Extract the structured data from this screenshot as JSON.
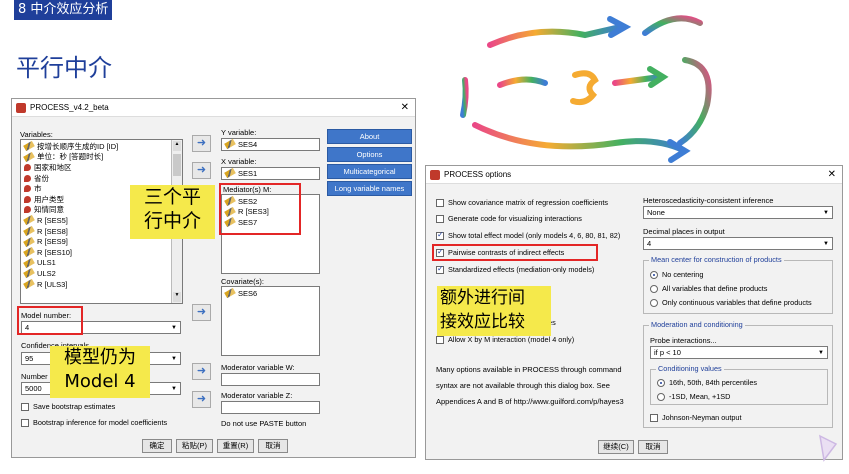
{
  "slide": {
    "section_tag": "8 中介效应分析",
    "title": "平行中介"
  },
  "dialog1": {
    "title": "PROCESS_v4.2_beta",
    "variables_label": "Variables:",
    "variables": [
      {
        "name": "按增长顺序生成的ID [ID]",
        "icon": "pencil-icon"
      },
      {
        "name": "单位：秒 [答题时长]",
        "icon": "pencil-icon"
      },
      {
        "name": "国家和地区",
        "icon": "nominal-icon"
      },
      {
        "name": "省份",
        "icon": "nominal-icon"
      },
      {
        "name": "市",
        "icon": "nominal-icon"
      },
      {
        "name": "用户类型",
        "icon": "nominal-icon"
      },
      {
        "name": "知情同意",
        "icon": "nominal-icon"
      },
      {
        "name": "R [SES5]",
        "icon": "pencil-icon"
      },
      {
        "name": "R [SES8]",
        "icon": "pencil-icon"
      },
      {
        "name": "R [SES9]",
        "icon": "pencil-icon"
      },
      {
        "name": "R [SES10]",
        "icon": "pencil-icon"
      },
      {
        "name": "ULS1",
        "icon": "pencil-icon"
      },
      {
        "name": "ULS2",
        "icon": "pencil-icon"
      },
      {
        "name": "R [ULS3]",
        "icon": "pencil-icon"
      }
    ],
    "y_label": "Y variable:",
    "y_value": "SES4",
    "x_label": "X variable:",
    "x_value": "SES1",
    "mediator_label": "Mediator(s) M:",
    "mediators": [
      "SES2",
      "R [SES3]",
      "SES7"
    ],
    "covariate_label": "Covariate(s):",
    "covariates": [
      "SES6"
    ],
    "modw_label": "Moderator variable W:",
    "modz_label": "Moderator variable Z:",
    "paste_note": "Do not use PASTE button",
    "model_number_label": "Model number:",
    "model_number_value": "4",
    "confidence_label": "Confidence intervals",
    "confidence_value": "95",
    "bootstrap_label": "Number of bootstrap samples",
    "bootstrap_value": "5000",
    "save_bootstrap": "Save bootstrap estimates",
    "bootstrap_inference": "Bootstrap inference for model coefficients",
    "side_buttons": [
      "About",
      "Options",
      "Multicategorical",
      "Long variable names"
    ],
    "bottom_buttons": [
      "确定",
      "粘贴(P)",
      "重置(R)",
      "取消"
    ]
  },
  "dialog2": {
    "title": "PROCESS options",
    "checkboxes": [
      {
        "label": "Show covariance matrix of regression coefficients",
        "checked": false
      },
      {
        "label": "Generate code for visualizing interactions",
        "checked": false
      },
      {
        "label": "Show total effect model (only models 4, 6, 80, 81, 82)",
        "checked": true
      },
      {
        "label": "Pairwise contrasts of indirect effects",
        "checked": true
      },
      {
        "label": "Standardized effects (mediation-only models)",
        "checked": true
      }
    ],
    "partial_values": "ues",
    "allow_xm": "Allow X by M interaction (model 4 only)",
    "note": [
      "Many options available in PROCESS through command",
      "syntax are not available through this dialog box.  See",
      "Appendices A and B of http://www.guilford.com/p/hayes3"
    ],
    "hc_label": "Heteroscedasticity-consistent inference",
    "hc_value": "None",
    "decimal_label": "Decimal places in output",
    "decimal_value": "4",
    "mean_center_title": "Mean center for construction of products",
    "mean_center_options": [
      {
        "label": "No centering",
        "on": true
      },
      {
        "label": "All variables that define products",
        "on": false
      },
      {
        "label": "Only continuous variables that define products",
        "on": false
      }
    ],
    "mod_title": "Moderation and conditioning",
    "probe_label": "Probe interactions...",
    "probe_value": "if p <  10",
    "cond_title": "Conditioning values",
    "cond_options": [
      {
        "label": "16th, 50th, 84th percentiles",
        "on": true
      },
      {
        "label": "-1SD, Mean, +1SD",
        "on": false
      }
    ],
    "jn_label": "Johnson-Neyman output",
    "buttons": [
      "继续(C)",
      "取消"
    ]
  },
  "callouts": {
    "mediators_note": "三个平\n行中介",
    "model_note": "模型仍为\nModel 4",
    "contrasts_note": "额外进行间\n接效应比较"
  },
  "colors": {
    "accent_blue": "#1f3f9a",
    "highlight_red": "#e32626",
    "callout_yellow": "#f5e94b"
  }
}
